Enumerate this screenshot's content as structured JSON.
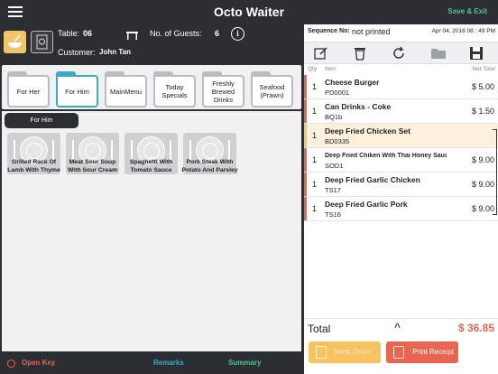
{
  "app": {
    "title": "Octo Waiter",
    "save_exit": "Save & Exit"
  },
  "header": {
    "table_label": "Table:",
    "table_value": "06",
    "guests_label": "No. of Guests:",
    "guests_value": "6",
    "customer_label": "Customer:",
    "customer_value": "John Tan",
    "info_symbol": "i"
  },
  "categories": [
    {
      "label": "For Her"
    },
    {
      "label": "For Him",
      "active": true
    },
    {
      "label": "MainMenu"
    },
    {
      "label": "Today Specials"
    },
    {
      "label": "Freshly Brewed Drinks"
    },
    {
      "label": "Seafood (Prawn)"
    }
  ],
  "section": {
    "label": "For Him"
  },
  "menu_items": [
    {
      "label": "Grilled Rack Of Lamb With Thyme"
    },
    {
      "label": "Meat Sour Soup With Sour Cream"
    },
    {
      "label": "Spaghetti With Tomato Sauce"
    },
    {
      "label": "Pork Steak With Potato And Parsley"
    }
  ],
  "bottom": {
    "open_key": "Open Key",
    "remarks": "Remarks",
    "summary": "Summary"
  },
  "order": {
    "sequence_label": "Sequence No:",
    "sequence_value": "not printed",
    "date": "Apr 04, 2016 08 : 49 PM",
    "col_qty": "Qty",
    "col_item": "Item",
    "col_total": "Net Total",
    "rows": [
      {
        "qty": "1",
        "name": "Cheese Burger",
        "code": "PD0001",
        "price": "$ 5.00"
      },
      {
        "qty": "1",
        "name": "Can Drinks - Coke",
        "code": "BQ1b",
        "price": "$ 1.50"
      },
      {
        "qty": "1",
        "name": "Deep Fried Chicken Set",
        "code": "BD0335",
        "price": ""
      },
      {
        "qty": "1",
        "name": "Deep Fried Chiken With Thai Honey Sauce",
        "code": "SOD1",
        "price": "$ 9.00"
      },
      {
        "qty": "1",
        "name": "Deep Fried Garlic Chicken",
        "code": "TS17",
        "price": "$ 9.00"
      },
      {
        "qty": "1",
        "name": "Deep Fried Garlic Pork",
        "code": "TS16",
        "price": "$ 9.00"
      }
    ],
    "total_label": "Total",
    "total_chevron": "^",
    "total_amount": "$ 36.85",
    "send_order": "Send Order",
    "print_receipt": "Print Receipt"
  },
  "colors": {
    "accent_green": "#4fc58a",
    "accent_blue": "#3fa9c3",
    "accent_red": "#e8654f",
    "accent_yellow": "#f7c35e"
  }
}
